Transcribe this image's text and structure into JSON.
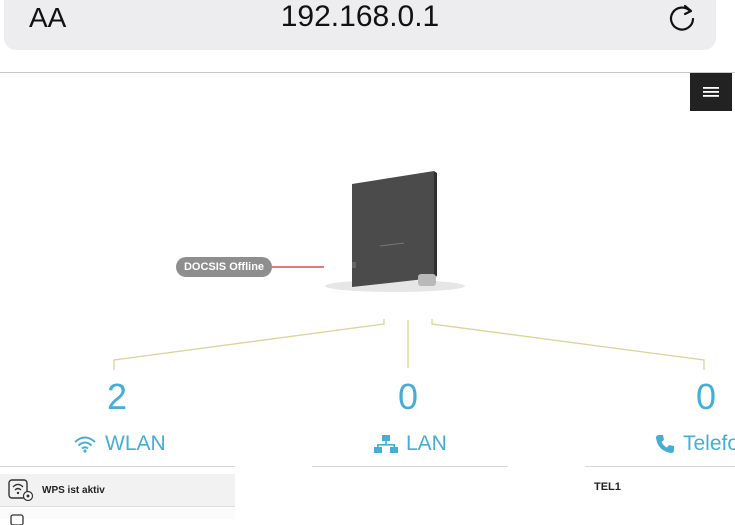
{
  "browser": {
    "text_size_label": "AA",
    "url": "192.168.0.1"
  },
  "device": {
    "status_label": "DOCSIS Offline"
  },
  "categories": [
    {
      "count": "2",
      "label": "WLAN",
      "icon": "wifi-icon"
    },
    {
      "count": "0",
      "label": "LAN",
      "icon": "network-icon"
    },
    {
      "count": "0",
      "label": "Telefo",
      "icon": "phone-icon"
    }
  ],
  "wlan_list": {
    "items": [
      {
        "label": "WPS ist aktiv",
        "icon": "wps-icon"
      }
    ]
  },
  "phone_list": {
    "items": [
      {
        "label": "TEL1"
      }
    ]
  },
  "colors": {
    "accent": "#45aed6",
    "status_badge": "#8e8e8e",
    "offline_line": "#d9262c",
    "connector_line": "#d8d49a",
    "menu_button": "#222222"
  }
}
